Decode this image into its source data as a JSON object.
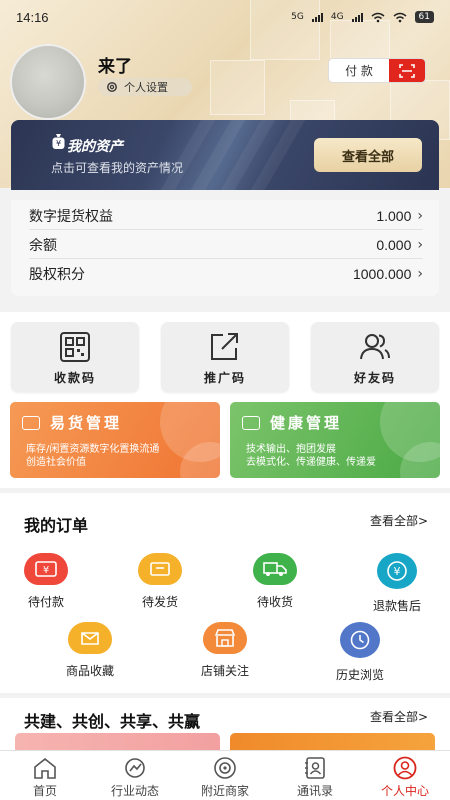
{
  "status_bar": {
    "time": "14:16",
    "network1": "5G",
    "network2": "4G",
    "battery": "61"
  },
  "profile": {
    "name": "来了",
    "settings_label": "个人设置"
  },
  "header_actions": {
    "pay_label": "付 款",
    "scan_icon": "scan-icon"
  },
  "assets": {
    "title": "我的资产",
    "subtitle": "点击可查看我的资产情况",
    "view_all": "查看全部",
    "rows": [
      {
        "label": "数字提货权益",
        "value": "1.000"
      },
      {
        "label": "余额",
        "value": "0.000"
      },
      {
        "label": "股权积分",
        "value": "1000.000"
      }
    ]
  },
  "quick_actions": [
    {
      "label": "收款码",
      "icon": "qr-code-icon"
    },
    {
      "label": "推广码",
      "icon": "share-icon"
    },
    {
      "label": "好友码",
      "icon": "friends-icon"
    }
  ],
  "promos": [
    {
      "title": "易货管理",
      "line1": "库存/闲置资源数字化置换流通",
      "line2": "创造社会价值",
      "color": "#f07432"
    },
    {
      "title": "健康管理",
      "line1": "技术输出、抱团发展",
      "line2": "去模式化、传递健康、传递爱",
      "color": "#5cb352"
    }
  ],
  "orders": {
    "title": "我的订单",
    "view_all": "查看全部>",
    "items": [
      {
        "label": "待付款",
        "icon": "wallet-icon",
        "color": "#f0473b"
      },
      {
        "label": "待发货",
        "icon": "box-icon",
        "color": "#f5b12a"
      },
      {
        "label": "待收货",
        "icon": "truck-icon",
        "color": "#3fb24c"
      },
      {
        "label": "退款售后",
        "icon": "refund-icon",
        "color": "#17a6c6"
      },
      {
        "label": "商品收藏",
        "icon": "favorite-bag-icon",
        "color": "#f5b12a"
      },
      {
        "label": "店铺关注",
        "icon": "store-icon",
        "color": "#f28a3a"
      },
      {
        "label": "历史浏览",
        "icon": "history-icon",
        "color": "#5277c8"
      }
    ]
  },
  "cobuild": {
    "title": "共建、共创、共享、共赢",
    "view_all": "查看全部>"
  },
  "tabbar": [
    {
      "label": "首页",
      "icon": "home-icon",
      "active": false
    },
    {
      "label": "行业动态",
      "icon": "trend-icon",
      "active": false
    },
    {
      "label": "附近商家",
      "icon": "nearby-icon",
      "active": false
    },
    {
      "label": "通讯录",
      "icon": "contacts-icon",
      "active": false
    },
    {
      "label": "个人中心",
      "icon": "user-icon",
      "active": true
    }
  ]
}
